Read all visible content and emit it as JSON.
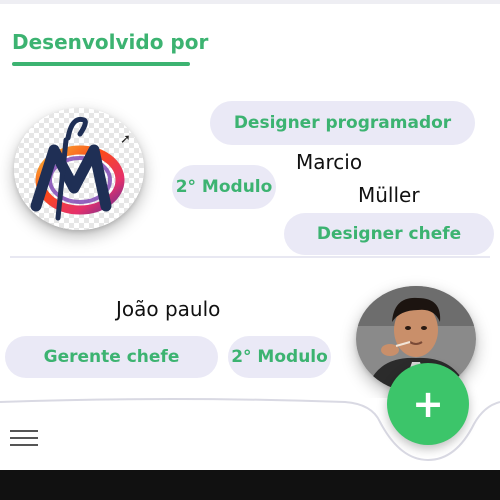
{
  "section": {
    "title": "Desenvolvido por"
  },
  "developer_1": {
    "name_line1": "Marcio",
    "name_line2": "Müller",
    "roles": [
      "Designer programador",
      "2° Modulo",
      "Designer chefe"
    ]
  },
  "developer_2": {
    "name": "João paulo",
    "roles": [
      "Gerente chefe",
      "2° Modulo"
    ]
  },
  "bottom_nav": {
    "menu_icon": "hamburger-menu-icon",
    "fab_icon": "plus-icon",
    "fab_label": "+"
  },
  "colors": {
    "accent": "#3cb371",
    "pill_bg": "#eae9f6",
    "fab": "#3cc56a"
  }
}
